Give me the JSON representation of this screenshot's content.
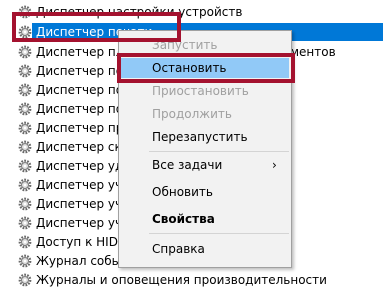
{
  "services": [
    {
      "label": "Диспетчер настройки устройств",
      "selected": false
    },
    {
      "label": "Диспетчер печати",
      "selected": true
    },
    {
      "label": "Диспетчер пла",
      "selected": false
    },
    {
      "label": "Диспетчер под",
      "selected": false
    },
    {
      "label": "Диспетчер под",
      "selected": false
    },
    {
      "label": "Диспетчер пол",
      "selected": false
    },
    {
      "label": "Диспетчер про",
      "selected": false
    },
    {
      "label": "Диспетчер ска",
      "selected": false
    },
    {
      "label": "Диспетчер удо",
      "selected": false
    },
    {
      "label": "Диспетчер уче",
      "selected": false
    },
    {
      "label": "Диспетчер уче",
      "selected": false
    },
    {
      "label": "Диспетчер уче",
      "selected": false
    },
    {
      "label": "Доступ к HID-у",
      "selected": false
    },
    {
      "label": "Журнал событ",
      "selected": false
    },
    {
      "label": "Журналы и оповещения производительности",
      "selected": false
    }
  ],
  "overflow_text": "ментов",
  "context_menu": {
    "items": [
      {
        "label": "Запустить",
        "state": "disabled",
        "name": "menu-item-start"
      },
      {
        "label": "Остановить",
        "state": "hover",
        "name": "menu-item-stop"
      },
      {
        "label": "Приостановить",
        "state": "disabled",
        "name": "menu-item-pause"
      },
      {
        "label": "Продолжить",
        "state": "disabled",
        "name": "menu-item-resume"
      },
      {
        "label": "Перезапустить",
        "state": "normal",
        "name": "menu-item-restart"
      },
      {
        "label": "Все задачи",
        "state": "normal",
        "name": "menu-item-all-tasks",
        "submenu": true
      },
      {
        "label": "Обновить",
        "state": "normal",
        "name": "menu-item-refresh"
      },
      {
        "label": "Свойства",
        "state": "bold",
        "name": "menu-item-properties"
      },
      {
        "label": "Справка",
        "state": "normal",
        "name": "menu-item-help"
      }
    ],
    "submenu_arrow": "›"
  },
  "colors": {
    "selection": "#0078d7",
    "menu_hover": "#91c9f7",
    "annotation_red": "#a4122f"
  }
}
